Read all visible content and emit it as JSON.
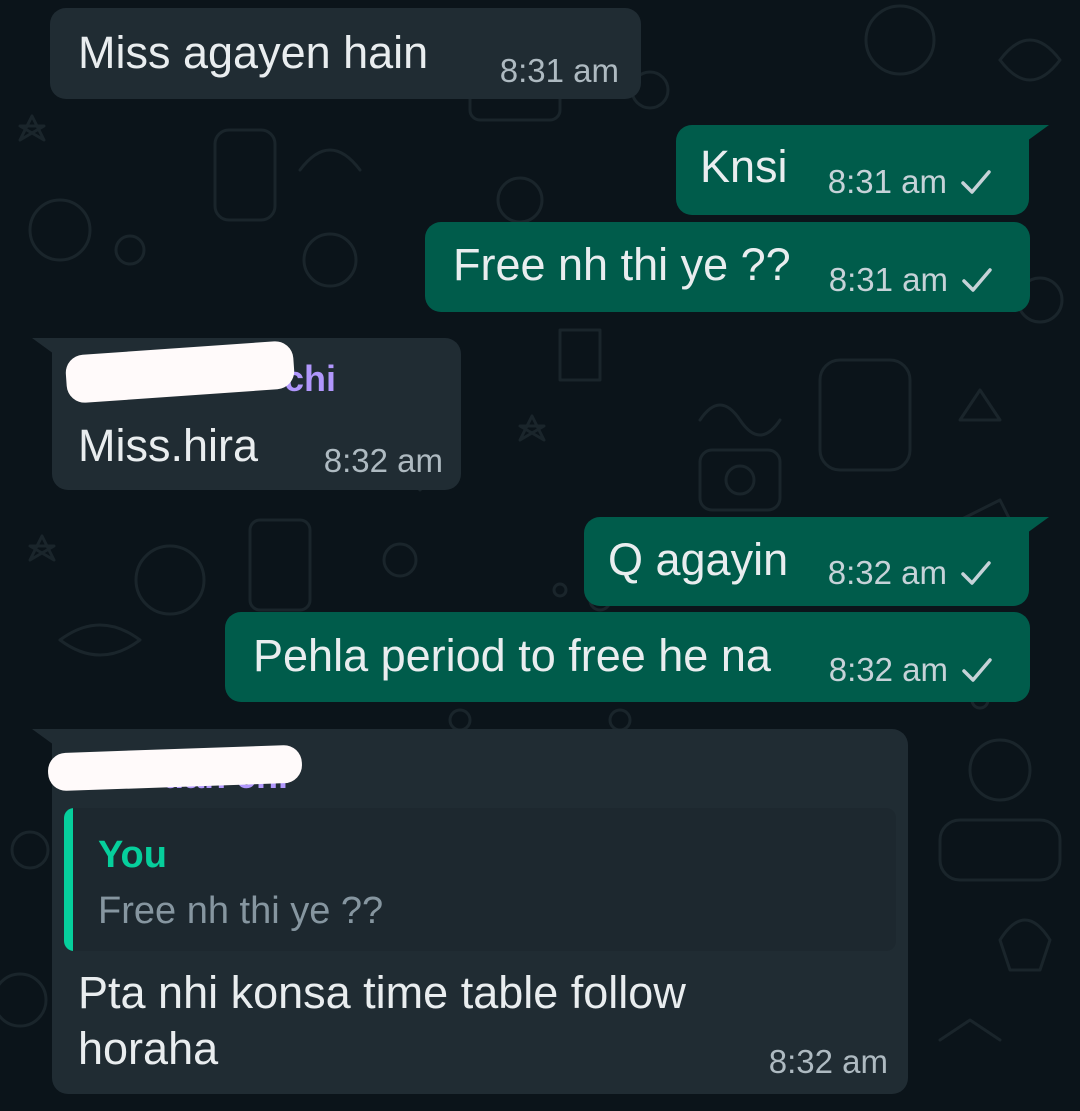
{
  "colors": {
    "background": "#0b141a",
    "incoming_bubble": "#202c33",
    "outgoing_bubble": "#005c4b",
    "sender_name": "#b197fc",
    "quote_accent": "#06cf9c"
  },
  "messages": [
    {
      "direction": "incoming",
      "text": "Miss agayen hain",
      "time": "8:31 am"
    },
    {
      "direction": "outgoing",
      "text": "Knsi",
      "time": "8:31 am",
      "status_icon": "sent-check-icon"
    },
    {
      "direction": "outgoing",
      "text": "Free nh thi ye ??",
      "time": "8:31 am",
      "status_icon": "sent-check-icon"
    },
    {
      "direction": "incoming",
      "sender_visible_fragment": "chi",
      "sender_redacted": true,
      "text": "Miss.hira",
      "time": "8:32 am"
    },
    {
      "direction": "outgoing",
      "text": "Q agayin",
      "time": "8:32 am",
      "status_icon": "sent-check-icon"
    },
    {
      "direction": "outgoing",
      "text": "Pehla period to free he na",
      "time": "8:32 am",
      "status_icon": "sent-check-icon"
    },
    {
      "direction": "incoming",
      "sender_visible_fragment": "uah chi",
      "sender_redacted": true,
      "quoted": {
        "author": "You",
        "text": "Free nh thi ye ??"
      },
      "text_lines": [
        "Pta nhi konsa time table follow",
        "horaha"
      ],
      "time": "8:32 am"
    }
  ]
}
